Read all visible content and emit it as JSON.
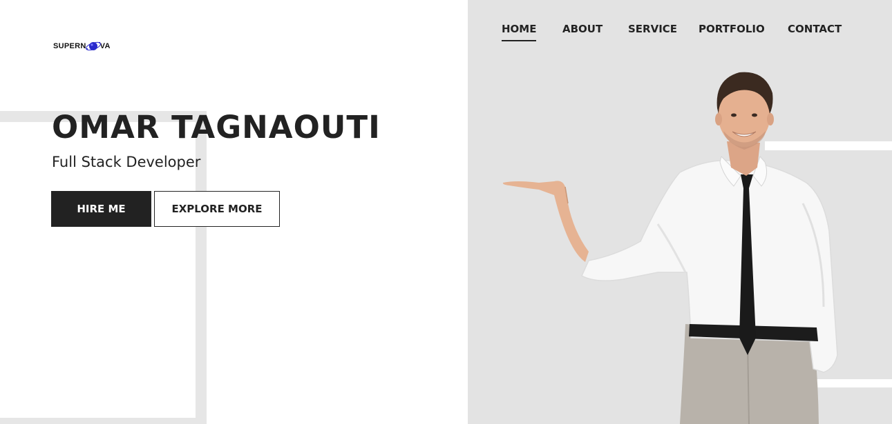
{
  "logo": {
    "text_left": "SUPERN",
    "text_right": "VA",
    "icon": "planet-orbit-icon",
    "accent": "#2a2acc"
  },
  "hero": {
    "name": "OMAR TAGNAOUTI",
    "role": "Full Stack Developer",
    "primary_button": "HIRE ME",
    "secondary_button": "EXPLORE MORE"
  },
  "nav": {
    "items": [
      {
        "label": "HOME",
        "active": true
      },
      {
        "label": "ABOUT",
        "active": false
      },
      {
        "label": "SERVICE",
        "active": false
      },
      {
        "label": "PORTFOLIO",
        "active": false
      },
      {
        "label": "CONTACT",
        "active": false
      }
    ]
  },
  "colors": {
    "dark": "#222222",
    "panel": "#e3e3e3",
    "frame": "#e6e6e6",
    "white": "#ffffff"
  },
  "illustration": "businessman-presenting-photo"
}
